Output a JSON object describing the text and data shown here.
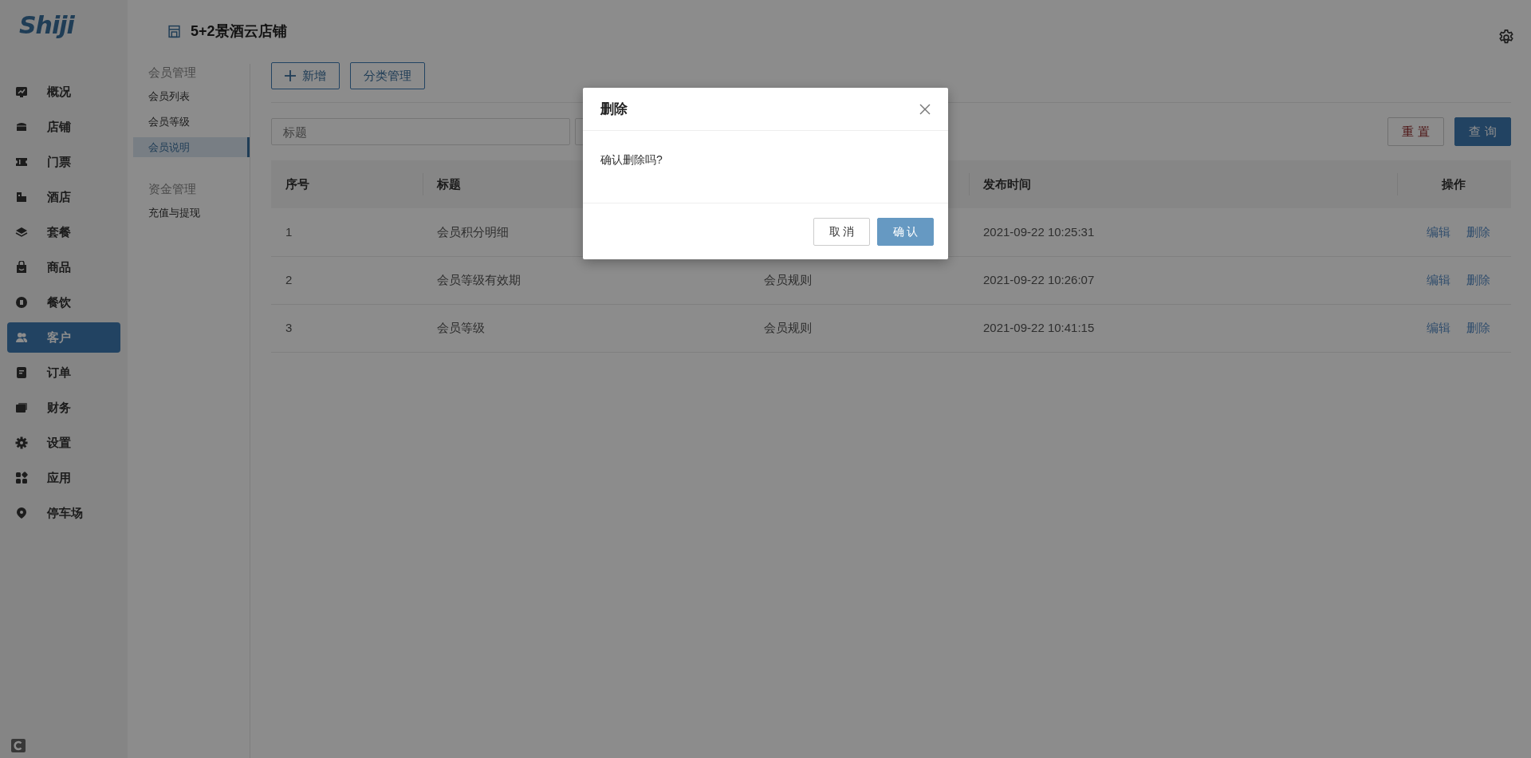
{
  "logo": {
    "text": "Shiji"
  },
  "sidebar": {
    "items": [
      {
        "label": "概况",
        "selected": false
      },
      {
        "label": "店铺",
        "selected": false
      },
      {
        "label": "门票",
        "selected": false
      },
      {
        "label": "酒店",
        "selected": false
      },
      {
        "label": "套餐",
        "selected": false
      },
      {
        "label": "商品",
        "selected": false
      },
      {
        "label": "餐饮",
        "selected": false
      },
      {
        "label": "客户",
        "selected": true
      },
      {
        "label": "订单",
        "selected": false
      },
      {
        "label": "财务",
        "selected": false
      },
      {
        "label": "设置",
        "selected": false
      },
      {
        "label": "应用",
        "selected": false
      },
      {
        "label": "停车场",
        "selected": false
      }
    ]
  },
  "header": {
    "title": "5+2景酒云店铺"
  },
  "submenu": {
    "groups": [
      {
        "title": "会员管理",
        "items": [
          {
            "label": "会员列表",
            "selected": false
          },
          {
            "label": "会员等级",
            "selected": false
          },
          {
            "label": "会员说明",
            "selected": true
          }
        ]
      },
      {
        "title": "资金管理",
        "items": [
          {
            "label": "充值与提现",
            "selected": false
          }
        ]
      }
    ]
  },
  "toolbar": {
    "buttons": [
      {
        "label": "新增",
        "kind": "add"
      },
      {
        "label": "分类管理",
        "kind": "plain"
      }
    ]
  },
  "filters": {
    "title_field": {
      "placeholder": "标题"
    },
    "buttons": [
      {
        "label": "重 置",
        "kind": "reset"
      },
      {
        "label": "查 询",
        "kind": "query"
      }
    ]
  },
  "table": {
    "columns": [
      "序号",
      "标题",
      null,
      "发布时间",
      "操作"
    ],
    "rows": [
      {
        "index": "1",
        "title": "会员积分明细",
        "published": "2021-09-22 10:25:31",
        "actions": [
          "编辑",
          "删除"
        ]
      },
      {
        "index": "2",
        "title": "会员等级有效期",
        "column_3": "会员规则",
        "published": "2021-09-22 10:26:07",
        "actions": [
          "编辑",
          "删除"
        ]
      },
      {
        "index": "3",
        "title": "会员等级",
        "column_3": "会员规则",
        "published": "2021-09-22 10:41:15",
        "actions": [
          "编辑",
          "删除"
        ]
      }
    ]
  },
  "dialog": {
    "title": "删除",
    "message": "确认删除吗?",
    "buttons": [
      {
        "label": "取 消",
        "kind": "cancel"
      },
      {
        "label": "确 认",
        "kind": "confirm"
      }
    ]
  }
}
